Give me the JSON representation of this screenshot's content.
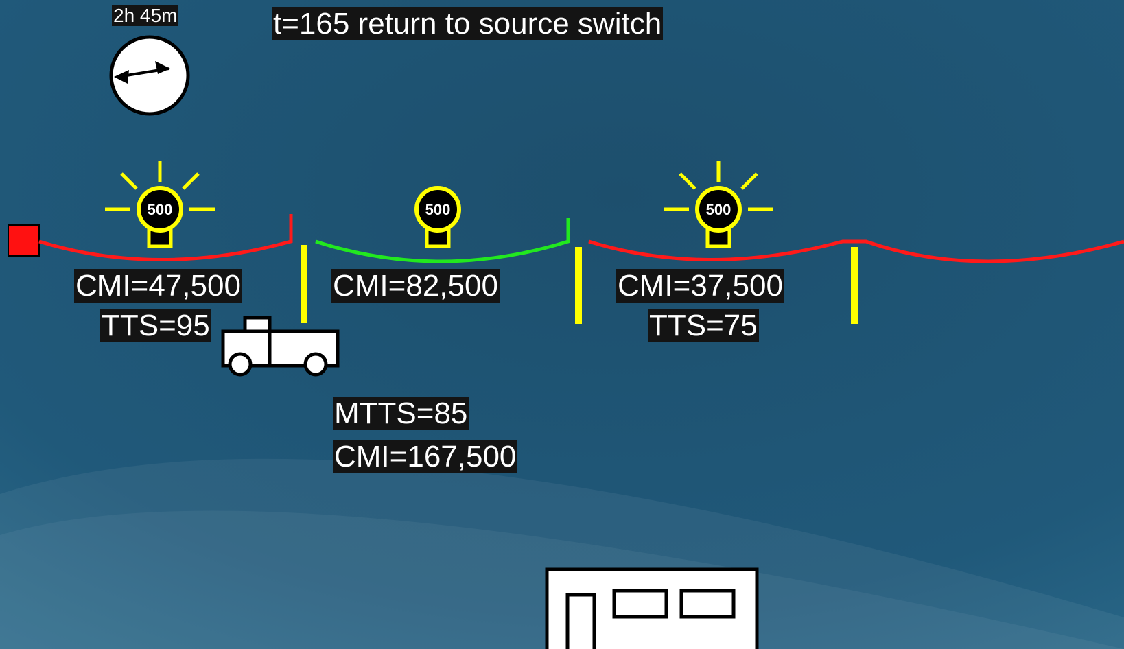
{
  "clock": {
    "duration": "2h 45m",
    "icon": "clock-icon"
  },
  "title": "t=165 return to source switch",
  "bulbs": [
    {
      "value": "500",
      "lit": true
    },
    {
      "value": "500",
      "lit": false
    },
    {
      "value": "500",
      "lit": true
    }
  ],
  "sections": [
    {
      "cmi": "CMI=47,500",
      "tts": "TTS=95",
      "status": "de-energized",
      "color": "#ff1a1a"
    },
    {
      "cmi": "CMI=82,500",
      "status": "energized",
      "color": "#22e81f"
    },
    {
      "cmi": "CMI=37,500",
      "tts": "TTS=75",
      "status": "de-energized",
      "color": "#ff1a1a"
    }
  ],
  "summary": {
    "mtts": "MTTS=85",
    "cmi": "CMI=167,500"
  },
  "icons": [
    "source-breaker-icon",
    "truck-icon",
    "substation-icon",
    "switch-icon"
  ],
  "colors": {
    "background": "#1f5674",
    "switch": "#ffff00",
    "bulb_outline": "#ffff00",
    "source": "#ff1111"
  }
}
